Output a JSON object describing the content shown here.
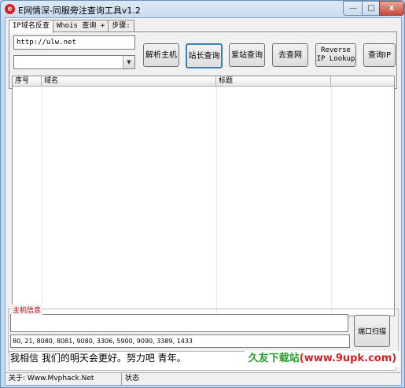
{
  "window": {
    "title": "E网情深-同服旁注查询工具v1.2",
    "icon": "app-e-icon",
    "min_glyph": "—",
    "max_glyph": "□",
    "close_glyph": "x"
  },
  "tabs": [
    {
      "label": "IP域名反查",
      "active": true
    },
    {
      "label": "Whois 查询 +",
      "active": false
    },
    {
      "label": "步骤:",
      "active": false
    }
  ],
  "search": {
    "url_value": "http://ulw.net",
    "combo_value": ""
  },
  "buttons": {
    "resolve": "解析主机",
    "zhanzhang": "站长查询",
    "aizhan": "爱站查询",
    "qu": "去查网",
    "reverse_ip": "Reverse IP Lookup",
    "query_ip": "查询IP"
  },
  "table": {
    "columns": [
      "序号",
      "域名",
      "标题"
    ],
    "rows": []
  },
  "host_info": {
    "label": "主机信息",
    "host_value": "",
    "ports_value": "80, 21, 8080, 8081, 9080, 3306, 5900, 9090, 3389, 1433",
    "scan_button": "端口扫描"
  },
  "message": "我相信 我们的明天会更好。努力吧 青年。",
  "statusbar": {
    "about": "关于: Www.Mvphack.Net",
    "state": "状态"
  },
  "watermark": {
    "prefix": "久友下载站",
    "link": "(www.9upk.com)"
  },
  "colors": {
    "accent": "#3c7fb1",
    "group_label": "#d00000",
    "watermark_green": "#2a9d2a",
    "watermark_red": "#d82020"
  }
}
